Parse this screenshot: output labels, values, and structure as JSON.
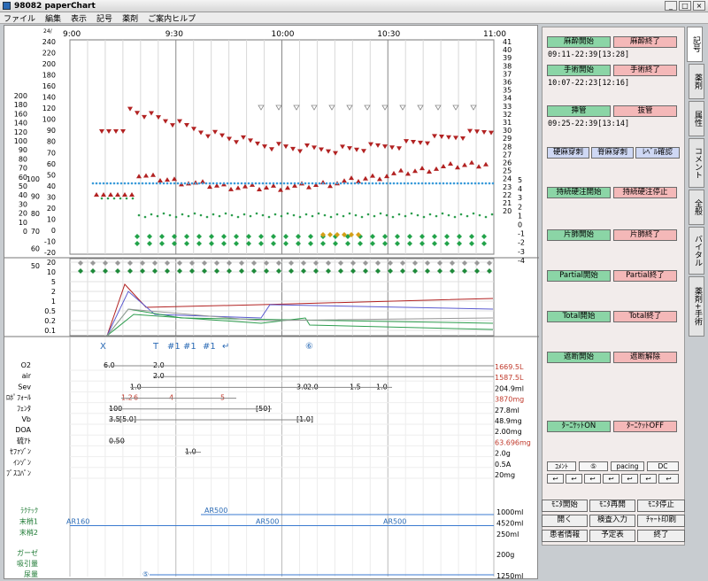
{
  "window": {
    "title": "98082 paperChart"
  },
  "menu": [
    "ファイル",
    "編集",
    "表示",
    "記号",
    "薬剤",
    "ご案内ヒルプ"
  ],
  "time_axis": {
    "date": "24/",
    "labels": [
      "9:00",
      "9:30",
      "10:00",
      "10:30",
      "11:00"
    ]
  },
  "left_scale_a": [
    "240",
    "220",
    "200",
    "180",
    "160",
    "140",
    "120",
    "100",
    "90",
    "80",
    "70",
    "60",
    "50",
    "40",
    "30",
    "20",
    "10",
    "0",
    "-10",
    "-20"
  ],
  "left_scale_b": [
    "200",
    "180",
    "160",
    "140",
    "120",
    "100",
    "90",
    "80",
    "70",
    "60",
    "50",
    "40",
    "30",
    "20",
    "10",
    "0"
  ],
  "left_scale_c": [
    "100",
    "90",
    "80",
    "70",
    "60",
    "50"
  ],
  "right_scale_a": [
    "41",
    "40",
    "39",
    "38",
    "37",
    "36",
    "35",
    "34",
    "33",
    "32",
    "31",
    "30",
    "29",
    "28",
    "27",
    "26",
    "25",
    "24",
    "23",
    "22",
    "21",
    "20"
  ],
  "right_scale_b": [
    "5",
    "4",
    "3",
    "2",
    "1",
    "0",
    "-1",
    "-2",
    "-3",
    "-4"
  ],
  "log_scale": [
    "20",
    "10",
    "5",
    "2",
    "1",
    "0.5",
    "0.2",
    "0.1"
  ],
  "event_marks": [
    "X",
    "T",
    "#1",
    "#1",
    "#1",
    "↵",
    "⑥"
  ],
  "drugs": [
    {
      "name": "O2",
      "total": "1669.5L",
      "total_color": "#c0392b",
      "doses": [
        "6.0",
        "2.0"
      ]
    },
    {
      "name": "air",
      "total": "1587.5L",
      "total_color": "#c0392b",
      "doses": [
        "2.0"
      ]
    },
    {
      "name": "Sev",
      "total": "204.9ml",
      "total_color": "#000",
      "doses": [
        "1.0",
        "3.0",
        "2.0",
        "1.5",
        "1.0"
      ]
    },
    {
      "name": "ﾌﾟﾛﾎﾟﾌｫｰﾙ",
      "total": "3870mg",
      "total_color": "#c0392b",
      "doses": [
        "1.2",
        "6",
        "4",
        "5"
      ]
    },
    {
      "name": "ﾌｪﾝﾀ",
      "total": "27.8ml",
      "total_color": "#000",
      "doses": [
        "100",
        "[50]"
      ]
    },
    {
      "name": "Vb",
      "total": "48.9mg",
      "total_color": "#000",
      "doses": [
        "3.5",
        "[5.0]",
        "[1.0]"
      ]
    },
    {
      "name": "DOA",
      "total": "2.00mg",
      "total_color": "#000",
      "doses": []
    },
    {
      "name": "硫ｱﾄ",
      "total": "63.696mg",
      "total_color": "#c0392b",
      "doses": [
        "0.50"
      ]
    },
    {
      "name": "ｾﾌｧｿﾞﾝ",
      "total": "2.0g",
      "total_color": "#000",
      "doses": [
        "1.0"
      ]
    },
    {
      "name": "ｲﾝｿﾞﾝ",
      "total": "0.5A",
      "total_color": "#000",
      "doses": []
    },
    {
      "name": "ﾌﾞｽｺﾊﾟﾝ",
      "total": "20mg",
      "total_color": "#000",
      "doses": []
    }
  ],
  "fluids": [
    {
      "name": "ﾗｸﾃｯｸ",
      "total": "1000ml",
      "doses": [
        "AR500"
      ]
    },
    {
      "name": "末梢1",
      "total": "4520ml",
      "doses": [
        "AR160",
        "AR500",
        "AR500"
      ]
    },
    {
      "name": "末梢2",
      "total": "250ml",
      "doses": []
    }
  ],
  "outputs": [
    {
      "name": "ガーゼ",
      "total": "200g"
    },
    {
      "name": "吸引量",
      "total": ""
    },
    {
      "name": "尿量",
      "total": "1250ml",
      "doses": [
        "⑤"
      ]
    }
  ],
  "panel": {
    "anes_start": "麻酔開始",
    "anes_end": "麻酔終了",
    "anes_time": "09:11-22:39[13:28]",
    "op_start": "手術開始",
    "op_end": "手術終了",
    "op_time": "10:07-22:23[12:16]",
    "intubate": "挿管",
    "extubate": "抜管",
    "tube_time": "09:25-22:39[13:14]",
    "block1": "硬麻穿刺",
    "block2": "脊麻穿刺",
    "block3": "ﾚﾍﾞﾙ確認",
    "epi_start": "持続硬注開始",
    "epi_stop": "持続硬注停止",
    "onelung_start": "片肺開始",
    "onelung_end": "片肺終了",
    "partial_start": "Partial開始",
    "partial_end": "Partial終了",
    "total_start": "Total開始",
    "total_end": "Total終了",
    "block_start": "遮断開始",
    "block_release": "遮断解除",
    "tourniquet_on": "ﾀｰﾆｹｯﾄON",
    "tourniquet_off": "ﾀｰﾆｹｯﾄOFF",
    "small": [
      "ｺﾒﾝﾄ",
      "⑤",
      "pacing",
      "DC"
    ],
    "arrows": [
      "↩",
      "↩",
      "↩",
      "↩",
      "↩",
      "↩",
      "↩"
    ]
  },
  "bottom": {
    "monitor_start": "ﾓﾆﾀ開始",
    "monitor_resume": "ﾓﾆﾀ再開",
    "monitor_stop": "ﾓﾆﾀ停止",
    "open": "開く",
    "lab_input": "検査入力",
    "chart_print": "ﾁｬｰﾄ印刷",
    "patient_info": "患者情報",
    "schedule": "予定表",
    "end": "終了"
  },
  "tabs": [
    "記号",
    "薬剤",
    "属性",
    "コメント",
    "全般",
    "バイタル",
    "薬剤+手術"
  ],
  "colors": {
    "green": "#8bd5a6",
    "pink": "#f4b8b8",
    "blue": "#cfd8f4",
    "hr": "#b22222",
    "spo2": "#3a9ad9",
    "sat": "#2e9e4f"
  }
}
